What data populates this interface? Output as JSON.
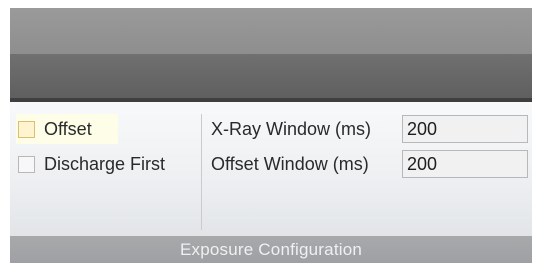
{
  "exposure_configuration": {
    "group_label": "Exposure Configuration",
    "offset_checkbox": {
      "label": "Offset"
    },
    "discharge_first_checkbox": {
      "label": "Discharge First"
    },
    "xray_window": {
      "label": "X-Ray Window (ms)",
      "value": "200"
    },
    "offset_window": {
      "label": "Offset Window (ms)",
      "value": "200"
    }
  }
}
